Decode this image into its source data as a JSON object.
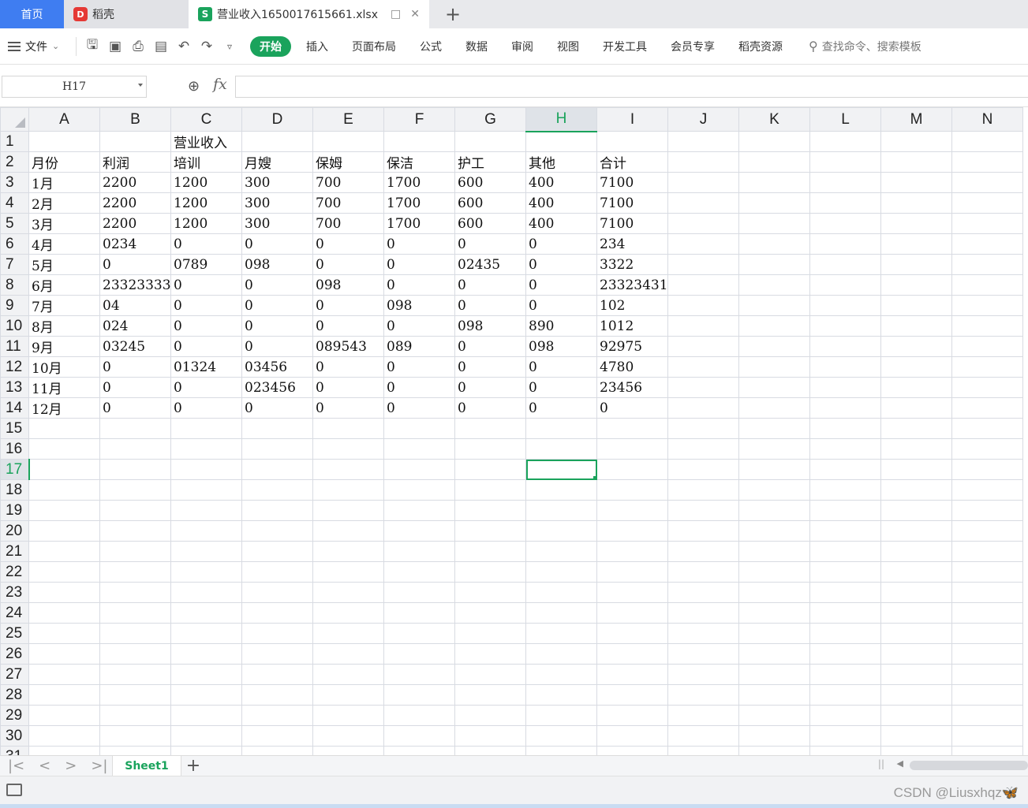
{
  "tabs": {
    "home": "首页",
    "daoke": "稻壳",
    "file": "营业收入1650017615661.xlsx",
    "daoke_logo": "D",
    "file_logo": "S"
  },
  "ribbon": {
    "file_menu": "文件",
    "items": [
      "开始",
      "插入",
      "页面布局",
      "公式",
      "数据",
      "审阅",
      "视图",
      "开发工具",
      "会员专享",
      "稻壳资源"
    ],
    "search_placeholder": "查找命令、搜索模板"
  },
  "formula_bar": {
    "cell_ref": "H17",
    "fx": "fx",
    "value": ""
  },
  "columns": [
    "A",
    "B",
    "C",
    "D",
    "E",
    "F",
    "G",
    "H",
    "I",
    "J",
    "K",
    "L",
    "M",
    "N"
  ],
  "selected_column": "H",
  "selected_row": 17,
  "rows": [
    [
      "",
      "",
      "营业收入",
      "",
      "",
      "",
      "",
      "",
      ""
    ],
    [
      "月份",
      "利润",
      "培训",
      "月嫂",
      "保姆",
      "保洁",
      "护工",
      "其他",
      "合计"
    ],
    [
      "1月",
      "2200",
      "1200",
      "300",
      "700",
      "1700",
      "600",
      "400",
      "7100"
    ],
    [
      "2月",
      "2200",
      "1200",
      "300",
      "700",
      "1700",
      "600",
      "400",
      "7100"
    ],
    [
      "3月",
      "2200",
      "1200",
      "300",
      "700",
      "1700",
      "600",
      "400",
      "7100"
    ],
    [
      "4月",
      "0234",
      "0",
      "0",
      "0",
      "0",
      "0",
      "0",
      "234"
    ],
    [
      "5月",
      "0",
      "0789",
      "098",
      "0",
      "0",
      "02435",
      "0",
      "3322"
    ],
    [
      "6月",
      "23323333",
      "0",
      "0",
      "098",
      "0",
      "0",
      "0",
      "23323431"
    ],
    [
      "7月",
      "04",
      "0",
      "0",
      "0",
      "098",
      "0",
      "0",
      "102"
    ],
    [
      "8月",
      "024",
      "0",
      "0",
      "0",
      "0",
      "098",
      "890",
      "1012"
    ],
    [
      "9月",
      "03245",
      "0",
      "0",
      "089543",
      "089",
      "0",
      "098",
      "92975"
    ],
    [
      "10月",
      "0",
      "01324",
      "03456",
      "0",
      "0",
      "0",
      "0",
      "4780"
    ],
    [
      "11月",
      "0",
      "0",
      "023456",
      "0",
      "0",
      "0",
      "0",
      "23456"
    ],
    [
      "12月",
      "0",
      "0",
      "0",
      "0",
      "0",
      "0",
      "0",
      "0"
    ]
  ],
  "row_count": 31,
  "sheet_tab": "Sheet1",
  "watermark": "CSDN @Liusxhqz🦋"
}
